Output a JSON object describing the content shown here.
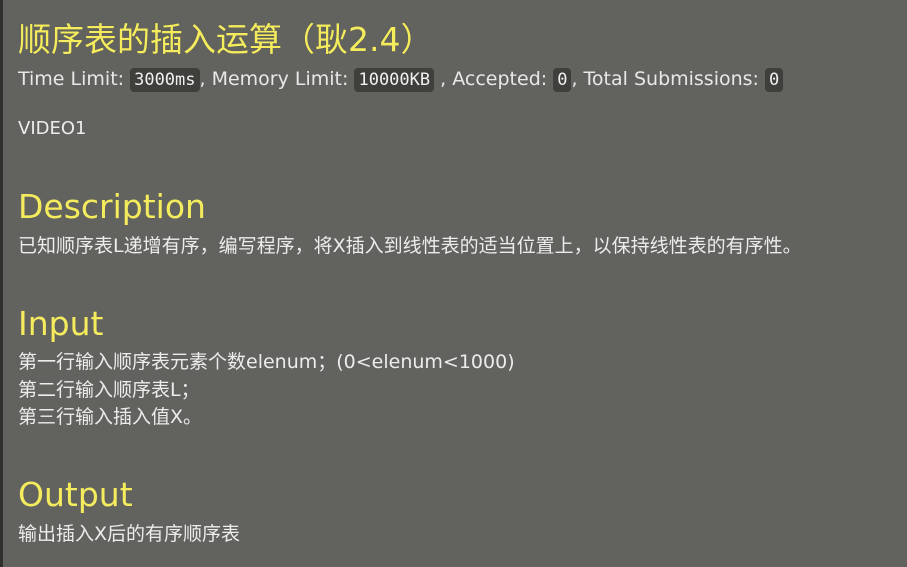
{
  "problem": {
    "title": "顺序表的插入运算（耿2.4）",
    "limits": {
      "time_label": "Time Limit:",
      "time_value": "3000ms",
      "memory_label": ", Memory Limit:",
      "memory_value": "10000KB",
      "accepted_label": ", Accepted:",
      "accepted_value": "0",
      "submissions_label": ", Total Submissions:",
      "submissions_value": "0"
    },
    "tag": "VIDEO1"
  },
  "description": {
    "heading": "Description",
    "text": "已知顺序表L递增有序，编写程序，将X插入到线性表的适当位置上，以保持线性表的有序性。"
  },
  "input": {
    "heading": "Input",
    "lines": [
      "第一行输入顺序表元素个数elenum；(0<elenum<1000)",
      "第二行输入顺序表L；",
      "第三行输入插入值X。"
    ]
  },
  "output": {
    "heading": "Output",
    "text": "输出插入X后的有序顺序表"
  }
}
